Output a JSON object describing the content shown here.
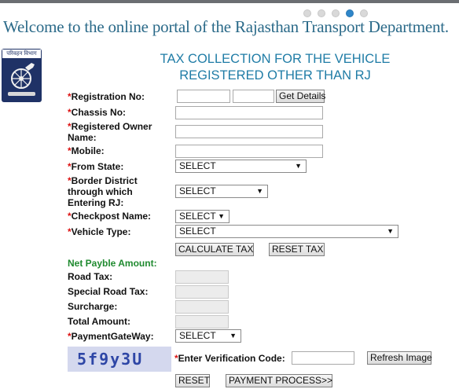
{
  "header": {
    "welcome": "Welcome to the online portal of the Rajasthan Transport Department.",
    "logo_text": "परिवहन विभाग"
  },
  "slider": {
    "count": 5,
    "active_index": 3
  },
  "form": {
    "title_line1": "TAX COLLECTION FOR THE VEHICLE",
    "title_line2": "REGISTERED OTHER THAN RJ",
    "required_marker": "*",
    "registration_label": "Registration No:",
    "get_details": "Get Details",
    "chassis_label": "Chassis No:",
    "owner_label_1": "Registered Owner",
    "owner_label_2": "Name:",
    "mobile_label": "Mobile:",
    "from_state_label": "From State:",
    "from_state_value": "SELECT",
    "border_label_1": "Border District",
    "border_label_2": "through which",
    "border_label_3": "Entering RJ:",
    "border_value": "SELECT",
    "checkpost_label": "Checkpost Name:",
    "checkpost_value": "SELECT",
    "vehicle_type_label": "Vehicle Type:",
    "vehicle_type_value": "SELECT",
    "calculate_tax": "CALCULATE TAX",
    "reset_tax": "RESET TAX",
    "net_payable_label": "Net Payble Amount:",
    "road_tax_label": "Road Tax:",
    "special_road_tax_label": "Special Road Tax:",
    "surcharge_label": "Surcharge:",
    "total_amount_label": "Total Amount:",
    "payment_gateway_label": "PaymentGateWay:",
    "payment_gateway_value": "SELECT",
    "captcha_text": "5f9y3U",
    "verification_label": "Enter Verification Code:",
    "refresh_image": "Refresh Image",
    "reset": "RESET",
    "payment_process": "PAYMENT PROCESS>>"
  },
  "colors": {
    "title": "#1f7ca6",
    "welcome": "#2b6a89",
    "required": "#dd1111",
    "net_payable": "#1f8a2f",
    "captcha_bg": "#d4d8ee",
    "captcha_text": "#2e46a6",
    "active_dot": "#2f86c9"
  }
}
